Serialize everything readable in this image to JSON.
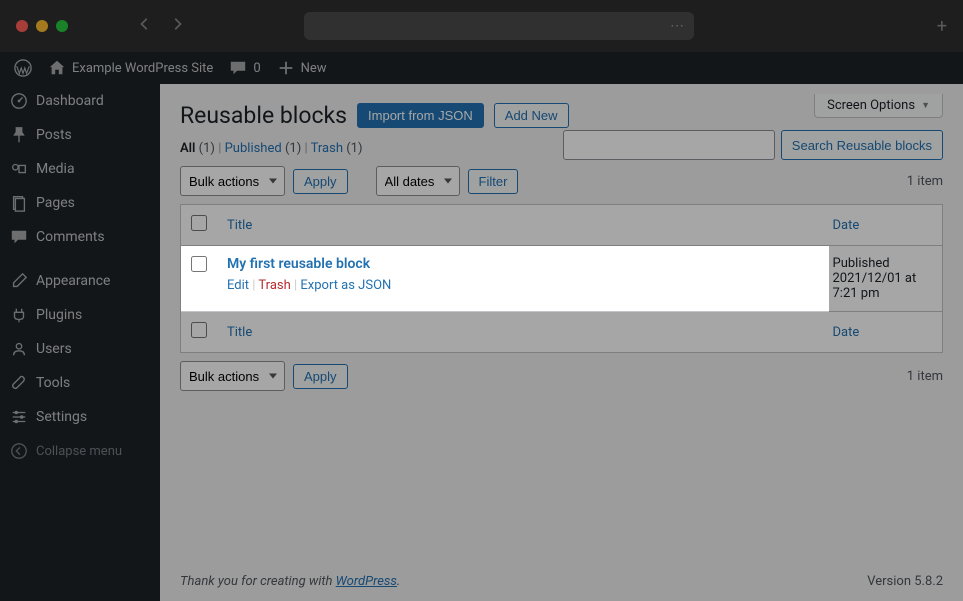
{
  "browser": {
    "address_icon": "⋯"
  },
  "adminbar": {
    "site_title": "Example WordPress Site",
    "comments_count": "0",
    "new_label": "New"
  },
  "sidebar": {
    "items": [
      {
        "label": "Dashboard"
      },
      {
        "label": "Posts"
      },
      {
        "label": "Media"
      },
      {
        "label": "Pages"
      },
      {
        "label": "Comments"
      },
      {
        "label": "Appearance"
      },
      {
        "label": "Plugins"
      },
      {
        "label": "Users"
      },
      {
        "label": "Tools"
      },
      {
        "label": "Settings"
      }
    ],
    "collapse": "Collapse menu"
  },
  "screen_options": "Screen Options",
  "header": {
    "title": "Reusable blocks",
    "import_btn": "Import from JSON",
    "add_btn": "Add New"
  },
  "filters": {
    "all_label": "All",
    "all_count": "(1)",
    "published_label": "Published",
    "published_count": "(1)",
    "trash_label": "Trash",
    "trash_count": "(1)"
  },
  "search": {
    "button": "Search Reusable blocks"
  },
  "tablenav": {
    "bulk_label": "Bulk actions",
    "apply": "Apply",
    "dates_label": "All dates",
    "filter": "Filter",
    "count": "1 item"
  },
  "table": {
    "col_title": "Title",
    "col_date": "Date",
    "row": {
      "title": "My first reusable block",
      "edit": "Edit",
      "trash": "Trash",
      "export": "Export as JSON",
      "date_status": "Published",
      "date_line": "2021/12/01 at 7:21 pm"
    }
  },
  "footer": {
    "thanks_prefix": "Thank you for creating with ",
    "wp": "WordPress",
    "version": "Version 5.8.2"
  }
}
